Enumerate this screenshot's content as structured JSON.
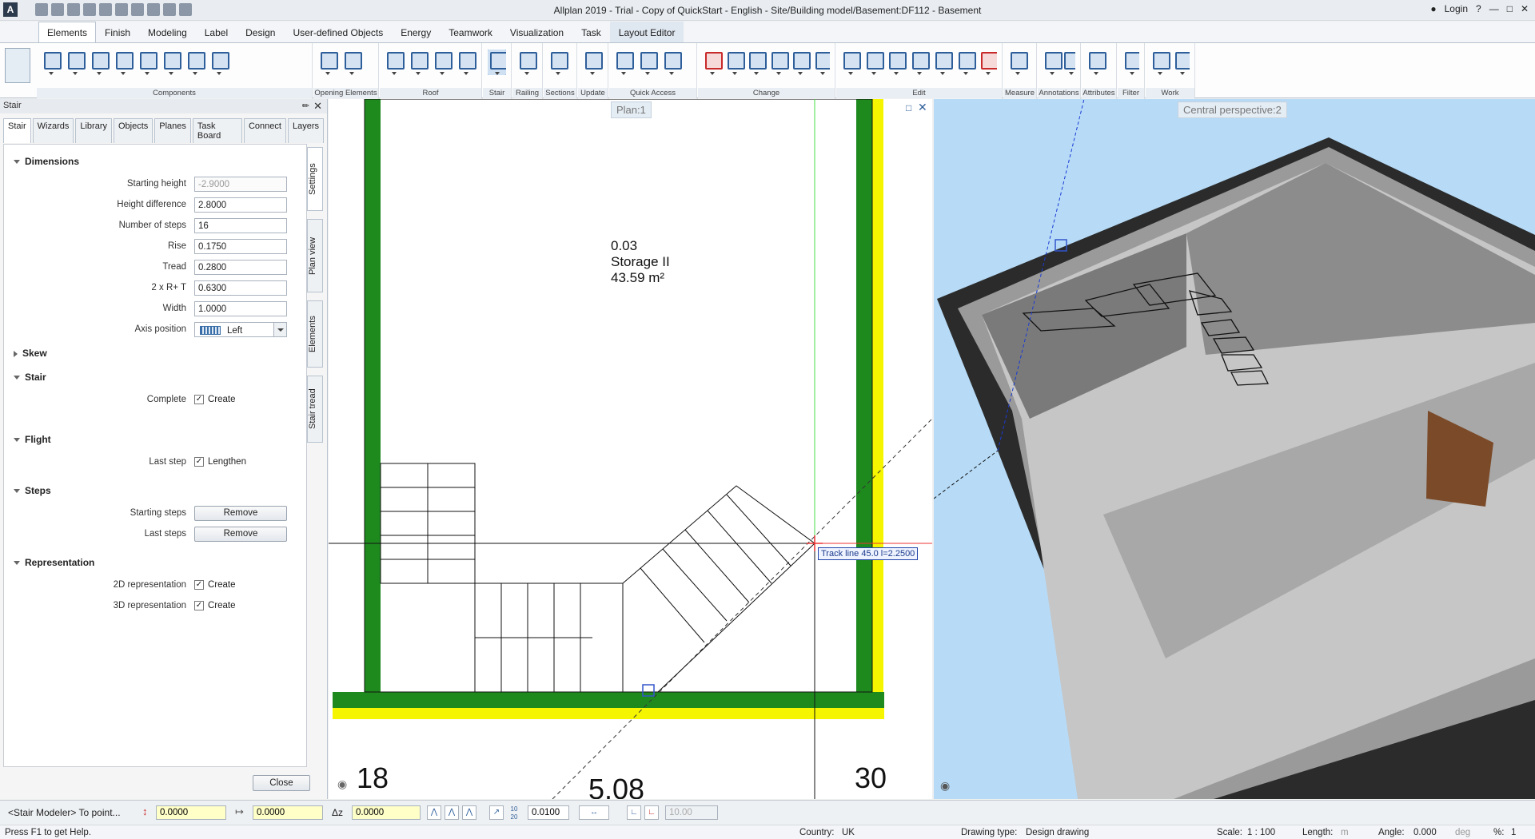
{
  "window": {
    "title": "Allplan 2019 - Trial - Copy of QuickStart - English - Site/Building model/Basement:DF112 - Basement",
    "login": "Login"
  },
  "menu_tabs": [
    {
      "label": "Elements",
      "active": true
    },
    {
      "label": "Finish"
    },
    {
      "label": "Modeling"
    },
    {
      "label": "Label"
    },
    {
      "label": "Design"
    },
    {
      "label": "User-defined Objects"
    },
    {
      "label": "Energy"
    },
    {
      "label": "Teamwork"
    },
    {
      "label": "Visualization"
    },
    {
      "label": "Task"
    },
    {
      "label": "Layout Editor",
      "boxed": true
    }
  ],
  "ribbon_groups": [
    "Components",
    "Opening Elements",
    "Roof",
    "Stair",
    "Railing",
    "Sections",
    "Update",
    "Quick Access",
    "Change",
    "Edit",
    "Measure",
    "Annotations",
    "Attributes",
    "Filter",
    "Work Environment"
  ],
  "panel": {
    "title": "Stair",
    "tabs": [
      "Stair",
      "Wizards",
      "Library",
      "Objects",
      "Planes",
      "Task Board",
      "Connect",
      "Layers"
    ],
    "vertical_tabs": [
      "Settings",
      "Plan view",
      "Elements",
      "Stair tread"
    ],
    "sections": {
      "dimensions": "Dimensions",
      "skew": "Skew",
      "stair": "Stair",
      "flight": "Flight",
      "steps": "Steps",
      "representation": "Representation"
    },
    "fields": {
      "starting_height": {
        "label": "Starting height",
        "value": "-2.9000"
      },
      "height_difference": {
        "label": "Height difference",
        "value": "2.8000"
      },
      "number_of_steps": {
        "label": "Number of steps",
        "value": "16"
      },
      "rise": {
        "label": "Rise",
        "value": "0.1750"
      },
      "tread": {
        "label": "Tread",
        "value": "0.2800"
      },
      "two_r_t": {
        "label": "2 x R+ T",
        "value": "0.6300"
      },
      "width": {
        "label": "Width",
        "value": "1.0000"
      },
      "axis_position": {
        "label": "Axis position",
        "value": "Left"
      }
    },
    "complete": {
      "label": "Complete",
      "value": "Create"
    },
    "last_step": {
      "label": "Last step",
      "value": "Lengthen"
    },
    "starting_steps": {
      "label": "Starting steps",
      "button": "Remove"
    },
    "last_steps": {
      "label": "Last steps",
      "button": "Remove"
    },
    "rep_2d": {
      "label": "2D representation",
      "value": "Create"
    },
    "rep_3d": {
      "label": "3D representation",
      "value": "Create"
    },
    "close": "Close"
  },
  "plan_view": {
    "label": "Plan:1",
    "room_number": "0.03",
    "room_name": "Storage II",
    "room_area": "43.59 m²",
    "track_tooltip": "Track line 45.0  l=2.2500",
    "dim_left": "18",
    "dim_mid": "5.08",
    "dim_right": "30"
  },
  "perspective_view": {
    "label": "Central perspective:2"
  },
  "command_bar": {
    "prompt": "<Stair Modeler> To point...",
    "x_value": "0.0000",
    "y_value": "0.0000",
    "dz_label": "Δz",
    "z_value": "0.0000",
    "step_value": "0.0100",
    "angle_value": "10.00"
  },
  "status_bar": {
    "help": "Press F1 to get Help.",
    "country_label": "Country:",
    "country": "UK",
    "drawing_type_label": "Drawing type:",
    "drawing_type": "Design drawing",
    "scale_label": "Scale:",
    "scale": "1 : 100",
    "length_label": "Length:",
    "length_unit": "m",
    "angle_label": "Angle:",
    "angle": "0.000",
    "angle_unit": "deg",
    "percent_label": "%:",
    "percent": "1"
  }
}
